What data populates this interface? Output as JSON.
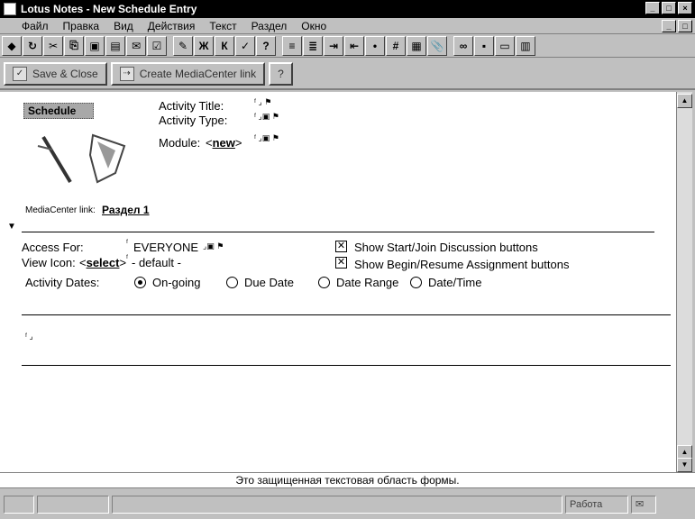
{
  "window": {
    "title": "Lotus Notes - New Schedule Entry"
  },
  "menu": {
    "items": [
      "Файл",
      "Правка",
      "Вид",
      "Действия",
      "Текст",
      "Раздел",
      "Окно"
    ]
  },
  "action_bar": {
    "save_close": "Save & Close",
    "create_link": "Create MediaCenter link",
    "help": "?"
  },
  "form": {
    "schedule_tab": "Schedule",
    "activity_title_label": "Activity Title:",
    "activity_type_label": "Activity Type:",
    "module_label": "Module:",
    "module_link": "new",
    "mediacenter_label": "MediaCenter link:",
    "mediacenter_value": "Раздел 1",
    "access_for_label": "Access For:",
    "access_for_value": "EVERYONE",
    "view_icon_label": "View Icon:",
    "view_icon_link": "select",
    "view_icon_value": "- default -",
    "show_discussion_label": "Show Start/Join Discussion buttons",
    "show_assignment_label": "Show Begin/Resume Assignment buttons",
    "activity_dates_label": "Activity Dates:",
    "date_options": [
      "On-going",
      "Due Date",
      "Date Range",
      "Date/Time"
    ],
    "selected_date_option": "On-going"
  },
  "hint": "Это защищенная текстовая область формы.",
  "status": {
    "mode": "Работа"
  }
}
